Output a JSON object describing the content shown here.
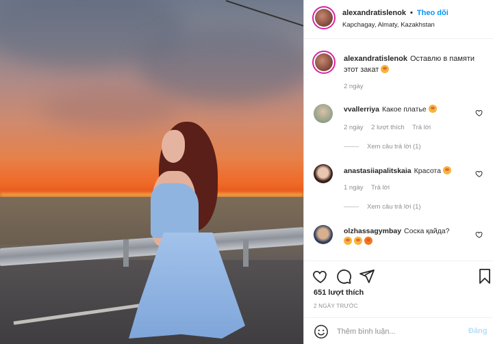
{
  "header": {
    "username": "alexandratislenok",
    "separator": "•",
    "follow_label": "Theo dõi",
    "location": "Kapchagay, Almaty, Kazakhstan"
  },
  "caption": {
    "username": "alexandratislenok",
    "text": "Оставлю в памяти этот закат",
    "time": "2 ngày"
  },
  "comments": [
    {
      "username": "vvallerriya",
      "text": "Какое платье",
      "time": "2 ngày",
      "likes": "2 lượt thích",
      "reply_label": "Trả lời",
      "view_replies": "Xem câu trả lời (1)"
    },
    {
      "username": "anastasiiapalitskaia",
      "text": "Красота",
      "time": "1 ngày",
      "reply_label": "Trả lời",
      "view_replies": "Xem câu trả lời (1)"
    },
    {
      "username": "olzhassagymbay",
      "text": "Соска қайда?"
    }
  ],
  "actions": {
    "likes": "651 lượt thích",
    "date": "2 NGÀY TRƯỚC",
    "comment_placeholder": "Thêm bình luận...",
    "post_label": "Đăng"
  },
  "colors": {
    "accent": "#0095f6",
    "post_disabled": "#b2dffc",
    "muted": "#8e8e8e"
  },
  "icons": [
    "heart-icon",
    "comment-icon",
    "share-icon",
    "bookmark-icon",
    "smile-icon"
  ]
}
